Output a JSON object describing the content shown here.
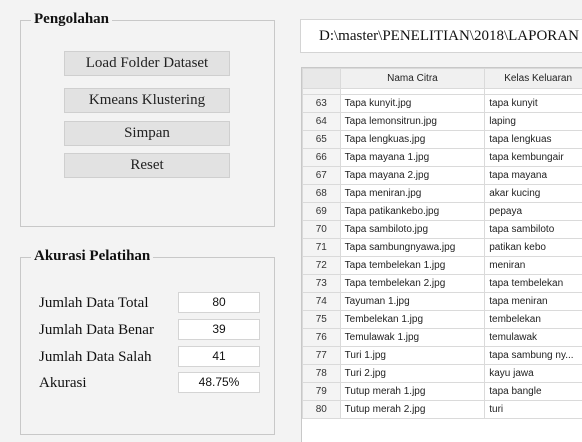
{
  "pengolahan": {
    "title": "Pengolahan",
    "buttons": {
      "load_folder": "Load Folder Dataset",
      "kmeans": "Kmeans Klustering",
      "simpan": "Simpan",
      "reset": "Reset"
    }
  },
  "akurasi": {
    "title": "Akurasi Pelatihan",
    "rows": [
      {
        "label": "Jumlah Data Total",
        "value": "80"
      },
      {
        "label": "Jumlah Data Benar",
        "value": "39"
      },
      {
        "label": "Jumlah Data Salah",
        "value": "41"
      },
      {
        "label": "Akurasi",
        "value": "48.75%"
      }
    ]
  },
  "path": "D:\\master\\PENELITIAN\\2018\\LAPORAN",
  "grid": {
    "columns": [
      "Nama Citra",
      "Kelas Keluaran"
    ],
    "rows": [
      {
        "no": "63",
        "nama": "Tapa kunyit.jpg",
        "kelas": "tapa kunyit"
      },
      {
        "no": "64",
        "nama": "Tapa lemonsitrun.jpg",
        "kelas": "laping"
      },
      {
        "no": "65",
        "nama": "Tapa lengkuas.jpg",
        "kelas": "tapa lengkuas"
      },
      {
        "no": "66",
        "nama": "Tapa mayana 1.jpg",
        "kelas": "tapa kembungair"
      },
      {
        "no": "67",
        "nama": "Tapa mayana 2.jpg",
        "kelas": "tapa mayana"
      },
      {
        "no": "68",
        "nama": "Tapa meniran.jpg",
        "kelas": "akar kucing"
      },
      {
        "no": "69",
        "nama": "Tapa patikankebo.jpg",
        "kelas": "pepaya"
      },
      {
        "no": "70",
        "nama": "Tapa sambiloto.jpg",
        "kelas": "tapa sambiloto"
      },
      {
        "no": "71",
        "nama": "Tapa sambungnyawa.jpg",
        "kelas": "patikan kebo"
      },
      {
        "no": "72",
        "nama": "Tapa tembelekan 1.jpg",
        "kelas": "meniran"
      },
      {
        "no": "73",
        "nama": "Tapa tembelekan 2.jpg",
        "kelas": "tapa tembelekan"
      },
      {
        "no": "74",
        "nama": "Tayuman 1.jpg",
        "kelas": "tapa meniran"
      },
      {
        "no": "75",
        "nama": "Tembelekan 1.jpg",
        "kelas": "tembelekan"
      },
      {
        "no": "76",
        "nama": "Temulawak 1.jpg",
        "kelas": "temulawak"
      },
      {
        "no": "77",
        "nama": "Turi 1.jpg",
        "kelas": "tapa sambung ny..."
      },
      {
        "no": "78",
        "nama": "Turi 2.jpg",
        "kelas": "kayu jawa"
      },
      {
        "no": "79",
        "nama": "Tutup merah 1.jpg",
        "kelas": "tapa bangle"
      },
      {
        "no": "80",
        "nama": "Tutup merah 2.jpg",
        "kelas": "turi"
      }
    ]
  }
}
